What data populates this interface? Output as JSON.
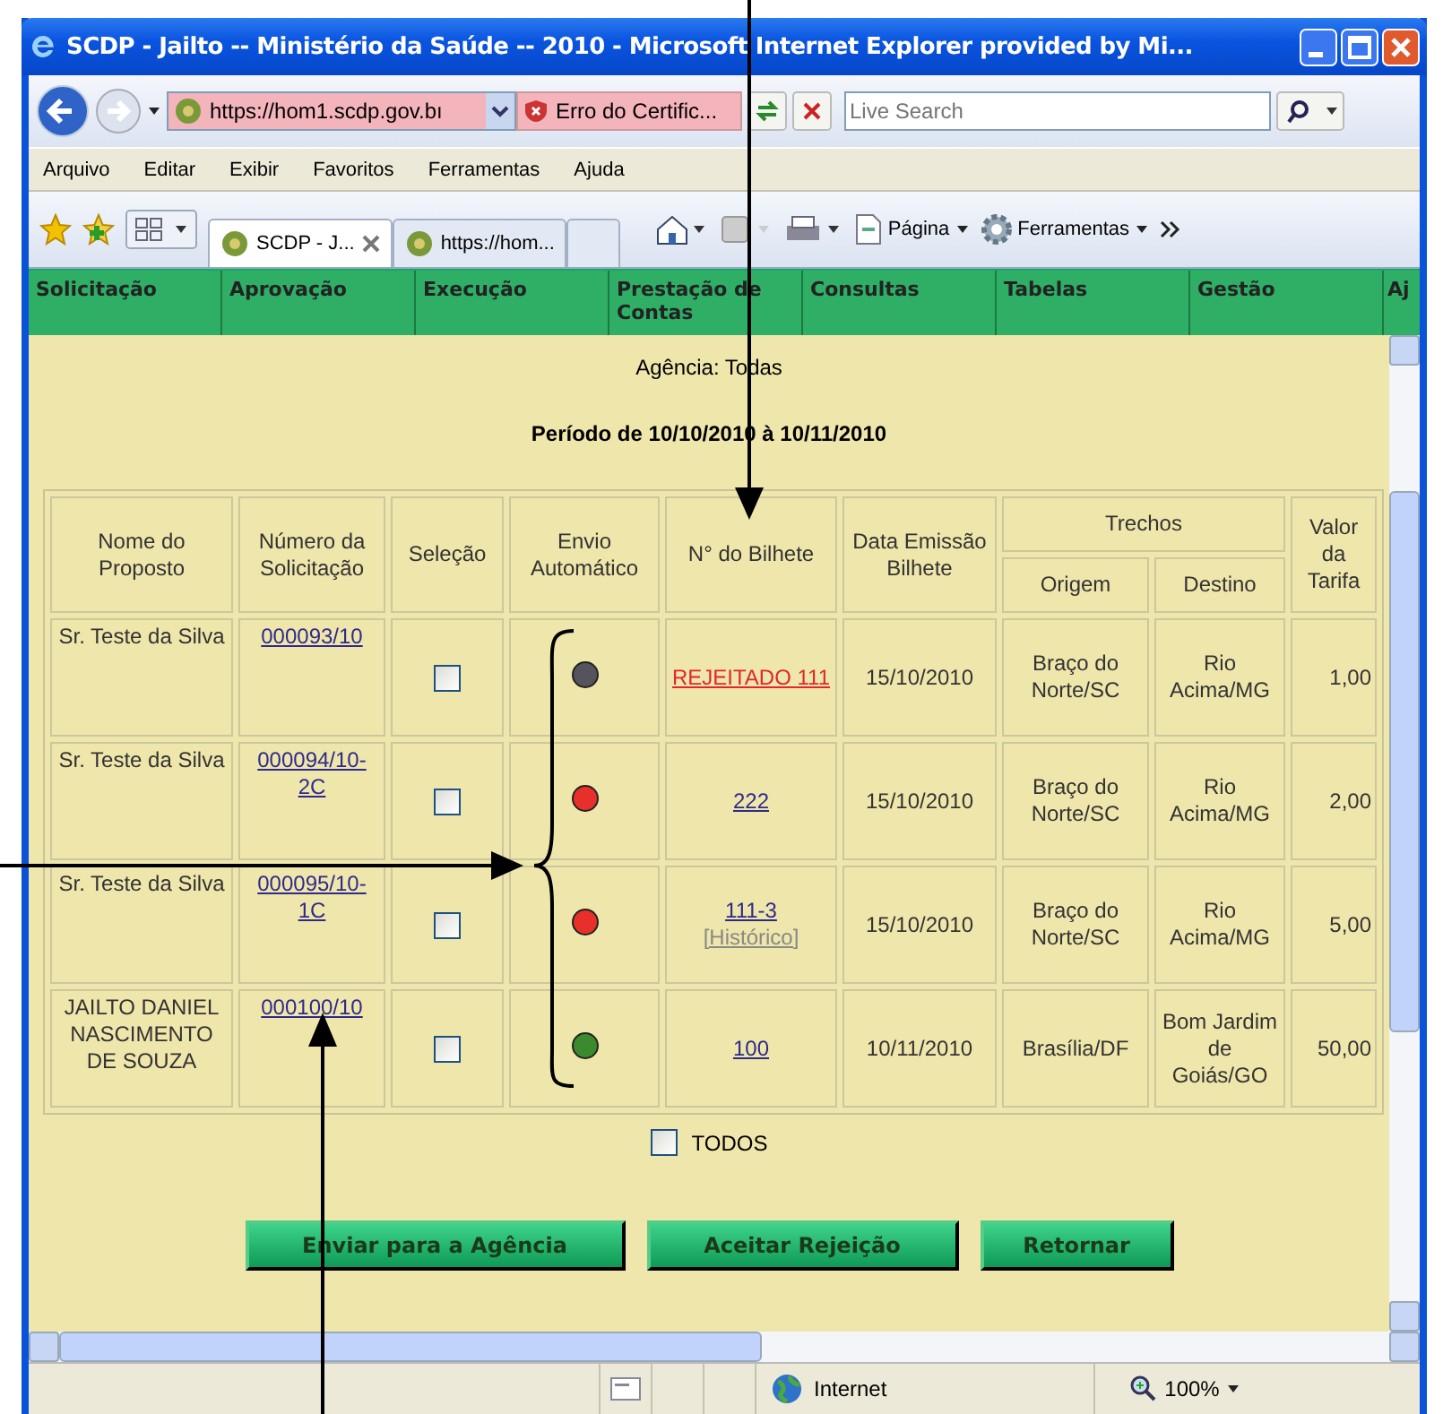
{
  "window": {
    "title": "SCDP - Jailto -- Ministério da Saúde -- 2010 - Microsoft Internet Explorer provided by Mi..."
  },
  "address_bar": {
    "url": "https://hom1.scdp.gov.bı",
    "certificate_error": "Erro do Certific...",
    "search_placeholder": "Live Search"
  },
  "menu": [
    "Arquivo",
    "Editar",
    "Exibir",
    "Favoritos",
    "Ferramentas",
    "Ajuda"
  ],
  "tabs": [
    {
      "label": "SCDP - J...",
      "selected": true
    },
    {
      "label": "https://hom...",
      "selected": false
    }
  ],
  "command_bar": [
    {
      "kind": "page",
      "label": "Página"
    },
    {
      "kind": "tools",
      "label": "Ferramentas"
    }
  ],
  "nav": [
    "Solicitação",
    "Aprovação",
    "Execução",
    "Prestação de Contas",
    "Consultas",
    "Tabelas",
    "Gestão",
    "Aj"
  ],
  "agency": "Agência: Todas",
  "period": "Período de 10/10/2010 à 10/11/2010",
  "table": {
    "columns": [
      "Nome do Proposto",
      "Número da Solicitação",
      "Seleção",
      "Envio Automático",
      "N° do Bilhete",
      "Data Emissão Bilhete",
      "Trechos",
      "Valor da Tarifa"
    ],
    "subcolumns": [
      "Origem",
      "Destino"
    ],
    "rows": [
      {
        "name": "Sr. Teste da Silva",
        "request": "000093/10",
        "checked": false,
        "color": "#55535c",
        "ticket": "REJEITADO 111",
        "rejected": true,
        "date": "15/10/2010",
        "origin": "Braço do Norte/SC",
        "destination": "Rio Acima/MG",
        "fare": "1,00"
      },
      {
        "name": "Sr. Teste da Silva",
        "request": "000094/10-2C",
        "checked": false,
        "color": "#e8302a",
        "ticket": "222",
        "rejected": false,
        "date": "15/10/2010",
        "origin": "Braço do Norte/SC",
        "destination": "Rio Acima/MG",
        "fare": "2,00"
      },
      {
        "name": "Sr. Teste da Silva",
        "request": "000095/10-1C",
        "checked": false,
        "color": "#e8302a",
        "ticket": "111-3",
        "history": "[Histórico]",
        "rejected": false,
        "date": "15/10/2010",
        "origin": "Braço do Norte/SC",
        "destination": "Rio Acima/MG",
        "fare": "5,00"
      },
      {
        "name": "JAILTO DANIEL NASCIMENTO DE SOUZA",
        "request": "000100/10",
        "checked": false,
        "color": "#3b8a2e",
        "ticket": "100",
        "rejected": false,
        "date": "10/11/2010",
        "origin": "Brasília/DF",
        "destination": "Bom Jardim de Goiás/GO",
        "fare": "50,00"
      }
    ]
  },
  "select_all": {
    "label": "TODOS",
    "checked": false
  },
  "buttons": [
    "Enviar para a Agência",
    "Aceitar Rejeição",
    "Retornar"
  ],
  "status_bar": {
    "zone": "Internet",
    "zoom": "100%"
  }
}
